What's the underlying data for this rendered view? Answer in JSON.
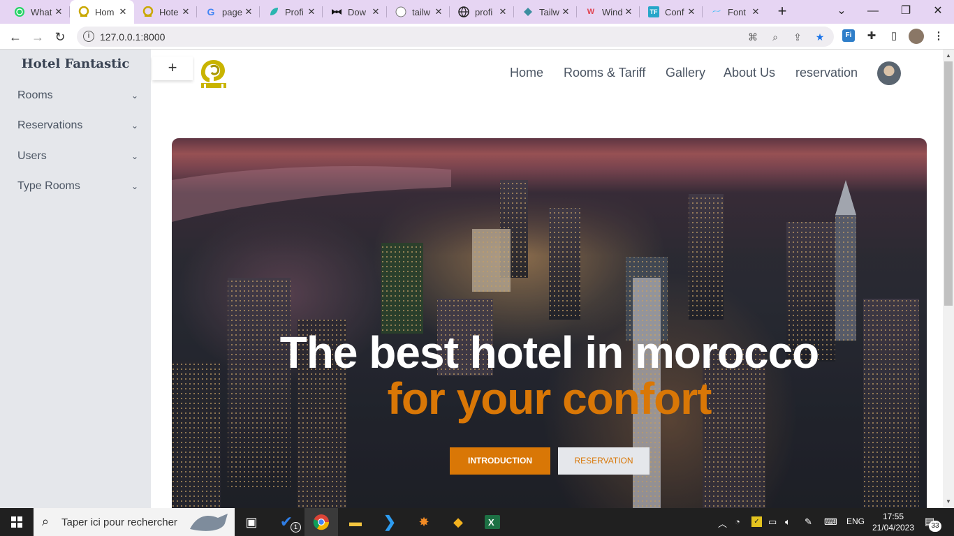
{
  "browser": {
    "tabs": [
      {
        "title": "What",
        "icon": "whatsapp-icon",
        "active": false
      },
      {
        "title": "Hom",
        "icon": "hotel-logo-icon",
        "active": true
      },
      {
        "title": "Hote",
        "icon": "hotel-logo-icon",
        "active": false
      },
      {
        "title": "page",
        "icon": "google-icon",
        "active": false
      },
      {
        "title": "Profi",
        "icon": "leaf-icon",
        "active": false
      },
      {
        "title": "Dow",
        "icon": "bow-icon",
        "active": false
      },
      {
        "title": "tailw",
        "icon": "github-icon",
        "active": false
      },
      {
        "title": "profi",
        "icon": "globe-icon",
        "active": false
      },
      {
        "title": "Tailw",
        "icon": "tailwind-icon",
        "active": false
      },
      {
        "title": "Wind",
        "icon": "windmill-icon",
        "active": false
      },
      {
        "title": "Conf",
        "icon": "tf-icon",
        "active": false
      },
      {
        "title": "Font",
        "icon": "tailwind-icon",
        "active": false
      }
    ],
    "url": "127.0.0.1:8000"
  },
  "sidebar": {
    "brand": "Hotel Fantastic",
    "items": [
      {
        "label": "Rooms"
      },
      {
        "label": "Reservations"
      },
      {
        "label": "Users"
      },
      {
        "label": "Type Rooms"
      }
    ]
  },
  "header": {
    "plus_label": "+",
    "nav": [
      {
        "label": "Home"
      },
      {
        "label": "Rooms & Tariff"
      },
      {
        "label": "Gallery"
      },
      {
        "label": "About Us"
      },
      {
        "label": "reservation"
      }
    ]
  },
  "hero": {
    "title": "The best hotel in morocco",
    "subtitle": "for your confort",
    "button_primary": "INTRODUCTION",
    "button_secondary": "RESERVATION",
    "accent_color": "#d97706"
  },
  "taskbar": {
    "search_placeholder": "Taper ici pour rechercher",
    "language": "ENG",
    "time": "17:55",
    "date": "21/04/2023",
    "notification_count": "33",
    "vscode_badge": "1"
  }
}
